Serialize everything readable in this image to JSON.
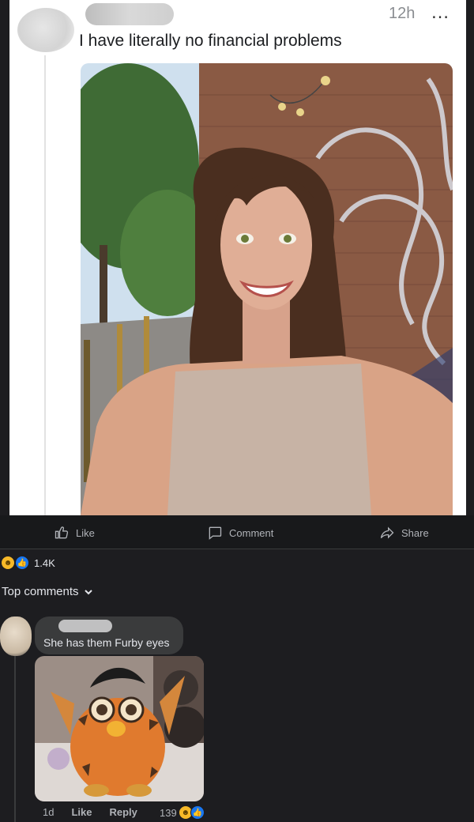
{
  "post": {
    "time": "12h",
    "more_icon": "…",
    "text": "I have literally no financial problems",
    "photo_icon": "selfie-photo"
  },
  "actions": {
    "like": "Like",
    "comment": "Comment",
    "share": "Share"
  },
  "reactions": {
    "count": "1.4K",
    "types": [
      "haha",
      "like"
    ]
  },
  "comments_header": "Top comments",
  "comment": {
    "text": "She has them Furby eyes",
    "time": "1d",
    "like_label": "Like",
    "reply_label": "Reply",
    "reaction_count": "139"
  },
  "colors": {
    "background": "#1d1d20",
    "bubble": "#3a3b3c",
    "like_blue": "#1877f2",
    "haha_yellow": "#f7b928"
  }
}
